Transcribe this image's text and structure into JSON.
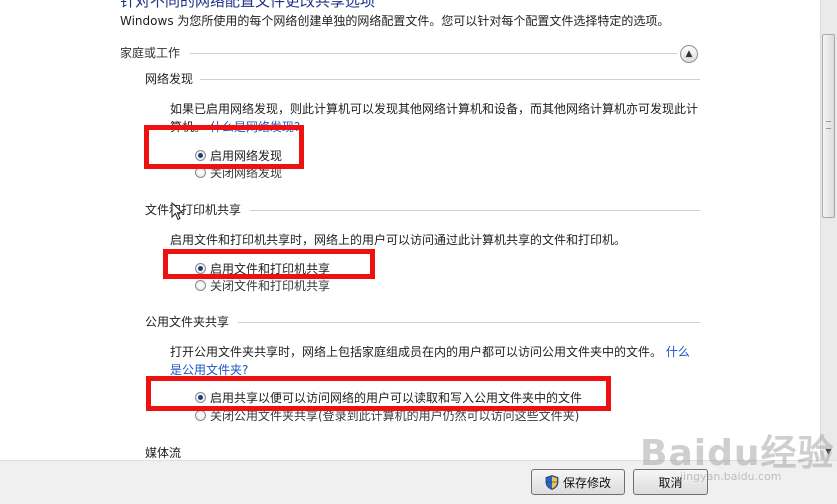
{
  "page": {
    "cut_title": "针对不同的网络配置文件更改共享选项",
    "intro": "Windows 为您所使用的每个网络创建单独的网络配置文件。您可以针对每个配置文件选择特定的选项。"
  },
  "group": {
    "label": "家庭或工作",
    "collapse_icon": "chevron-up-icon"
  },
  "network_discovery": {
    "label": "网络发现",
    "description": "如果已启用网络发现，则此计算机可以发现其他网络计算机和设备，而其他网络计算机亦可发现此计算机。",
    "link": "什么是网络发现?",
    "options": [
      {
        "label": "启用网络发现",
        "checked": true
      },
      {
        "label": "关闭网络发现",
        "checked": false
      }
    ]
  },
  "file_printer_sharing": {
    "label": "文件和打印机共享",
    "description": "启用文件和打印机共享时，网络上的用户可以访问通过此计算机共享的文件和打印机。",
    "options": [
      {
        "label": "启用文件和打印机共享",
        "checked": true
      },
      {
        "label": "关闭文件和打印机共享",
        "checked": false
      }
    ]
  },
  "public_folder_sharing": {
    "label": "公用文件夹共享",
    "description": "打开公用文件夹共享时，网络上包括家庭组成员在内的用户都可以访问公用文件夹中的文件。",
    "link": "什么是公用文件夹?",
    "options": [
      {
        "label": "启用共享以便可以访问网络的用户可以读取和写入公用文件夹中的文件",
        "checked": true
      },
      {
        "label": "关闭公用文件夹共享(登录到此计算机的用户仍然可以访问这些文件夹)",
        "checked": false
      }
    ]
  },
  "media_streaming": {
    "label": "媒体流"
  },
  "footer": {
    "save_label": "保存修改",
    "cancel_label": "取消"
  },
  "watermark": {
    "text": "Baidu经验",
    "url": "jingyan.baidu.com"
  },
  "colors": {
    "highlight_box": "#ee1111",
    "link": "#1a56c6"
  }
}
